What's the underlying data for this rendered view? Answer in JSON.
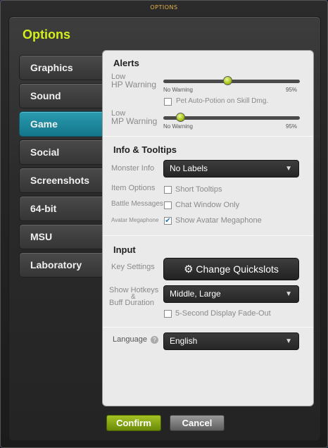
{
  "window": {
    "title": "OPTIONS"
  },
  "header": {
    "title": "Options"
  },
  "tabs": [
    {
      "label": "Graphics"
    },
    {
      "label": "Sound"
    },
    {
      "label": "Game"
    },
    {
      "label": "Social"
    },
    {
      "label": "Screenshots"
    },
    {
      "label": "64-bit"
    },
    {
      "label": "MSU"
    },
    {
      "label": "Laboratory"
    }
  ],
  "active_tab": "Game",
  "alerts": {
    "title": "Alerts",
    "hp": {
      "label_line1": "Low",
      "label_line2": "HP Warning",
      "min_label": "No Warning",
      "max_label": "95%",
      "value_fraction": 0.47
    },
    "pet_auto_potion": {
      "label": "Pet Auto-Potion on Skill Dmg.",
      "checked": false
    },
    "mp": {
      "label_line1": "Low",
      "label_line2": "MP Warning",
      "min_label": "No Warning",
      "max_label": "95%",
      "value_fraction": 0.1
    }
  },
  "info": {
    "title": "Info & Tooltips",
    "monster_info": {
      "label": "Monster Info",
      "value": "No Labels"
    },
    "item_options": {
      "label": "Item Options",
      "option": "Short Tooltips",
      "checked": false
    },
    "battle_messages": {
      "label": "Battle Messages",
      "option": "Chat Window Only",
      "checked": false
    },
    "avatar_megaphone": {
      "label": "Avatar Megaphone",
      "option": "Show Avatar Megaphone",
      "checked": true
    }
  },
  "input": {
    "title": "Input",
    "key_settings": {
      "label": "Key Settings",
      "button": "Change Quickslots"
    },
    "show_hotkeys": {
      "label_line1": "Show Hotkeys",
      "label_line2": "&",
      "label_line3": "Buff Duration",
      "value": "Middle, Large"
    },
    "fade_out": {
      "label": "5-Second Display Fade-Out",
      "checked": false
    }
  },
  "language": {
    "label": "Language",
    "value": "English"
  },
  "footer": {
    "confirm": "Confirm",
    "cancel": "Cancel"
  },
  "colors": {
    "accent": "#d4ef1a",
    "active_tab": "#1d8aa0",
    "confirm": "#8aac14"
  }
}
